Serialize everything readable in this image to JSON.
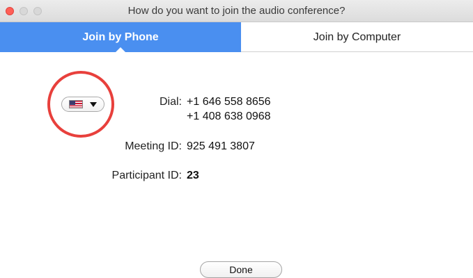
{
  "window": {
    "title": "How do you want to join the audio conference?"
  },
  "tabs": [
    {
      "label": "Join by Phone",
      "active": true
    },
    {
      "label": "Join by Computer",
      "active": false
    }
  ],
  "country_select": {
    "selected": "United States",
    "flag_icon": "us-flag-icon"
  },
  "dial": {
    "label": "Dial:",
    "numbers": [
      "+1 646 558 8656",
      "+1 408 638 0968"
    ]
  },
  "meeting": {
    "label": "Meeting ID:",
    "value": "925 491 3807"
  },
  "participant": {
    "label": "Participant ID:",
    "value": "23"
  },
  "buttons": {
    "done": "Done"
  },
  "colors": {
    "accent": "#4a8ff0",
    "highlight_ring": "#e8403c",
    "close_button": "#ff5f57"
  }
}
